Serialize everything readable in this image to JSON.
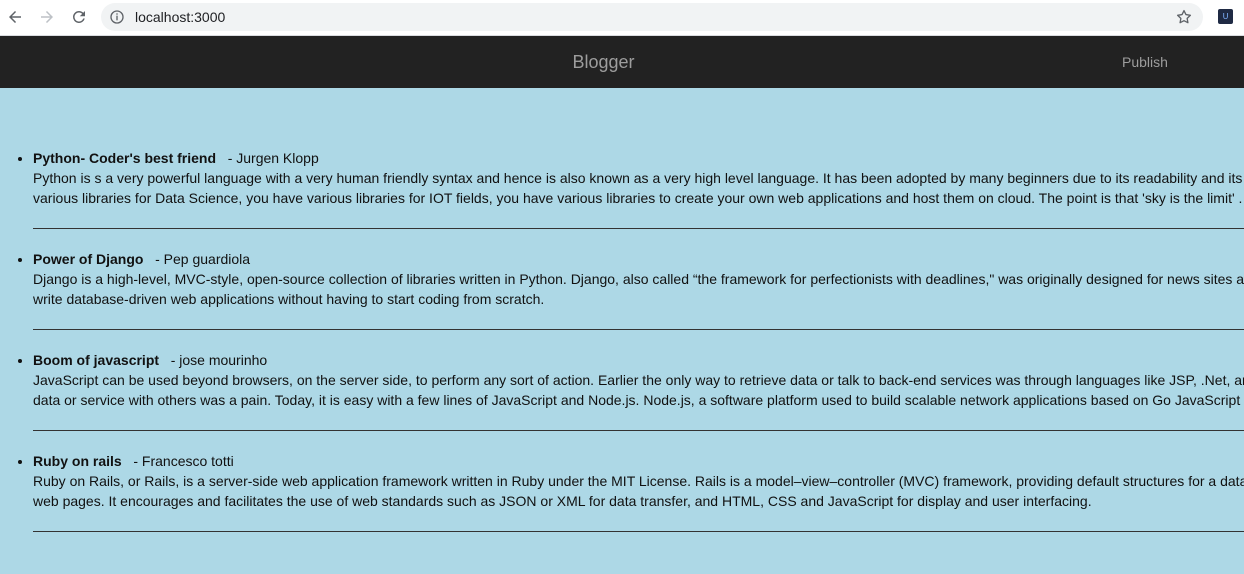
{
  "browser": {
    "url": "localhost:3000"
  },
  "header": {
    "brand": "Blogger",
    "publish_label": "Publish"
  },
  "posts": [
    {
      "title": "Python- Coder's best friend",
      "author": "- Jurgen Klopp",
      "body": "Python is s a very powerful language with a very human friendly syntax and hence is also known as a very high level language. It has been adopted by many beginners due to its readability and its syntax.You have various libraries for Data Science, you have various libraries for IOT fields, you have various libraries to create your own web applications and host them on cloud. The point is that 'sky is the limit' ."
    },
    {
      "title": "Power of Django",
      "author": "- Pep guardiola",
      "body": "Django is a high-level, MVC-style, open-source collection of libraries written in Python. Django, also called “the framework for perfectionists with deadlines,\" was originally designed for news sites a developers to write database-driven web applications without having to start coding from scratch."
    },
    {
      "title": "Boom of javascript",
      "author": "- jose mourinho",
      "body": "JavaScript can be used beyond browsers, on the server side, to perform any sort of action. Earlier the only way to retrieve data or talk to back-end services was through languages like JSP, .Net, an sharing that data or service with others was a pain. Today, it is easy with a few lines of JavaScript and Node.js. Node.js, a software platform used to build scalable network applications based on Go JavaScript engine."
    },
    {
      "title": "Ruby on rails",
      "author": "- Francesco totti",
      "body": "Ruby on Rails, or Rails, is a server-side web application framework written in Ruby under the MIT License. Rails is a model–view–controller (MVC) framework, providing default structures for a data service, and web pages. It encourages and facilitates the use of web standards such as JSON or XML for data transfer, and HTML, CSS and JavaScript for display and user interfacing."
    }
  ]
}
